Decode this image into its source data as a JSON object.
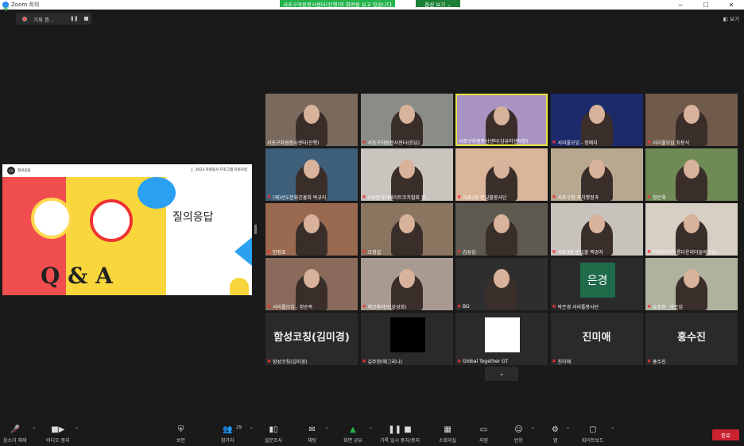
{
  "window": {
    "title": "Zoom 회의",
    "minimize": "─",
    "maximize": "☐",
    "close": "✕"
  },
  "share_banner": {
    "text": "서초구자원봉사센터(진행)의 화면을 보고 있습니다",
    "options": "옵션 보기 ⌄"
  },
  "recording": {
    "label": "기록 중..."
  },
  "view_button": "보기",
  "slide": {
    "logo": "CS",
    "brand": "질의응답",
    "program": "2023 자원봉사 프로그램 지원사업",
    "title": "질의응답",
    "qa": "Q & A"
  },
  "participants": [
    {
      "name": "서초구자원봉사센터(진행)",
      "type": "video",
      "bg": "#7a6a5e",
      "muted": false
    },
    {
      "name": "서초구자원봉사센터(응답)",
      "type": "video",
      "bg": "#8a8d86",
      "muted": true
    },
    {
      "name": "서초구자원봉사센터(김유미센터장)",
      "type": "video",
      "bg": "#a993c2",
      "muted": false,
      "active": true
    },
    {
      "name": "서리풀모임 - 정예지",
      "type": "video",
      "bg": "#1d2a6a",
      "muted": true
    },
    {
      "name": "서리풀모임 최용식",
      "type": "video",
      "bg": "#705a4a",
      "muted": true
    },
    {
      "name": "(재)선도문화진흥회 박규리",
      "type": "video",
      "bg": "#3d5f7a",
      "muted": true
    },
    {
      "name": "(사)한국디베이트코치협회 황...",
      "type": "video",
      "bg": "#c9c4be",
      "muted": true
    },
    {
      "name": "서초1동 반딧불봉사단",
      "type": "video",
      "bg": "#d9b59a",
      "muted": true
    },
    {
      "name": "서초구청 자치행정과",
      "type": "video",
      "bg": "#b8a890",
      "muted": true
    },
    {
      "name": "정은희",
      "type": "video",
      "bg": "#6f8a55",
      "muted": true
    },
    {
      "name": "한정호",
      "type": "video",
      "bg": "#9a6a50",
      "muted": true
    },
    {
      "name": "오정섭",
      "type": "video",
      "bg": "#8a7560",
      "muted": true
    },
    {
      "name": "김성심",
      "type": "video",
      "bg": "#5e5a50",
      "muted": true
    },
    {
      "name": "서초3동 반딧불 백경자",
      "type": "video",
      "bg": "#c7c2bc",
      "muted": true
    },
    {
      "name": "아리모아(아름다운리더들의모임)...",
      "type": "video",
      "bg": "#d7cec4",
      "muted": true
    },
    {
      "name": "서리풀모임 - 정순복",
      "type": "video",
      "bg": "#8a6a5a",
      "muted": true
    },
    {
      "name": "헤코파이브(강성희)",
      "type": "video",
      "bg": "#a89a90",
      "muted": true
    },
    {
      "name": "BG",
      "type": "video",
      "bg": "#2e2e2e",
      "muted": true
    },
    {
      "name": "박은경 서리풀봉사단",
      "type": "avatar",
      "avatar_text": "은경",
      "avatar_bg": "#1f6b4a",
      "muted": true
    },
    {
      "name": "유초현 _아트업",
      "type": "video",
      "bg": "#b0b2a0",
      "muted": true
    },
    {
      "name": "함성코칭(김미경)",
      "type": "name",
      "big": "함성코칭(김미경)",
      "muted": true
    },
    {
      "name": "김주현(에그리나)",
      "type": "avatar",
      "avatar_text": "",
      "avatar_bg": "#000000",
      "muted": true
    },
    {
      "name": "Global Together GT",
      "type": "avatar",
      "avatar_text": "",
      "avatar_bg": "#ffffff",
      "muted": true
    },
    {
      "name": "진미애",
      "type": "name",
      "big": "진미애",
      "muted": true
    },
    {
      "name": "홍수진",
      "type": "name",
      "big": "홍수진",
      "muted": true
    }
  ],
  "more_button": "⌄",
  "toolbar": {
    "mute_label": "음소거 해제",
    "video_label": "비디오 중지",
    "security_label": "보안",
    "participants_label": "참가자",
    "participants_count": "29",
    "polls_label": "설문조사",
    "chat_label": "채팅",
    "share_label": "화면 공유",
    "record_label": "기록 일시 중지/중지",
    "breakout_label": "소회의실",
    "support_label": "지원",
    "reactions_label": "반응",
    "apps_label": "앱",
    "whiteboard_label": "화이트보드",
    "end_label": "종료"
  }
}
